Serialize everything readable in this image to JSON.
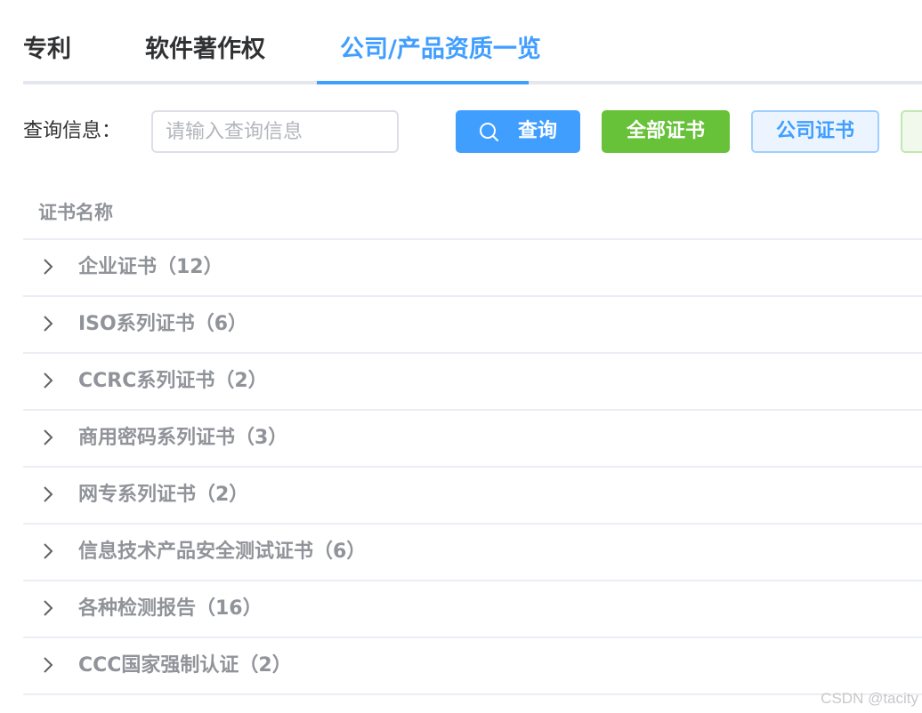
{
  "tabs": [
    {
      "label": "专利"
    },
    {
      "label": "软件著作权"
    },
    {
      "label": "公司/产品资质一览"
    }
  ],
  "active_tab_index": 2,
  "search": {
    "label": "查询信息：",
    "placeholder": "请输入查询信息",
    "value": ""
  },
  "buttons": {
    "query": "查询",
    "all_certs": "全部证书",
    "company_certs": "公司证书"
  },
  "table": {
    "header": "证书名称",
    "rows": [
      {
        "label": "企业证书（12）"
      },
      {
        "label": "ISO系列证书（6）"
      },
      {
        "label": "CCRC系列证书（2）"
      },
      {
        "label": "商用密码系列证书（3）"
      },
      {
        "label": "网专系列证书（2）"
      },
      {
        "label": "信息技术产品安全测试证书（6）"
      },
      {
        "label": "各种检测报告（16）"
      },
      {
        "label": "CCC国家强制认证（2）"
      }
    ]
  },
  "watermark": "CSDN @tacity",
  "colors": {
    "primary": "#409eff",
    "success": "#67c23a",
    "text_main": "#303133",
    "text_secondary": "#909399"
  },
  "icons": {
    "query_button": "search-icon",
    "row_expand": "chevron-right-icon"
  }
}
